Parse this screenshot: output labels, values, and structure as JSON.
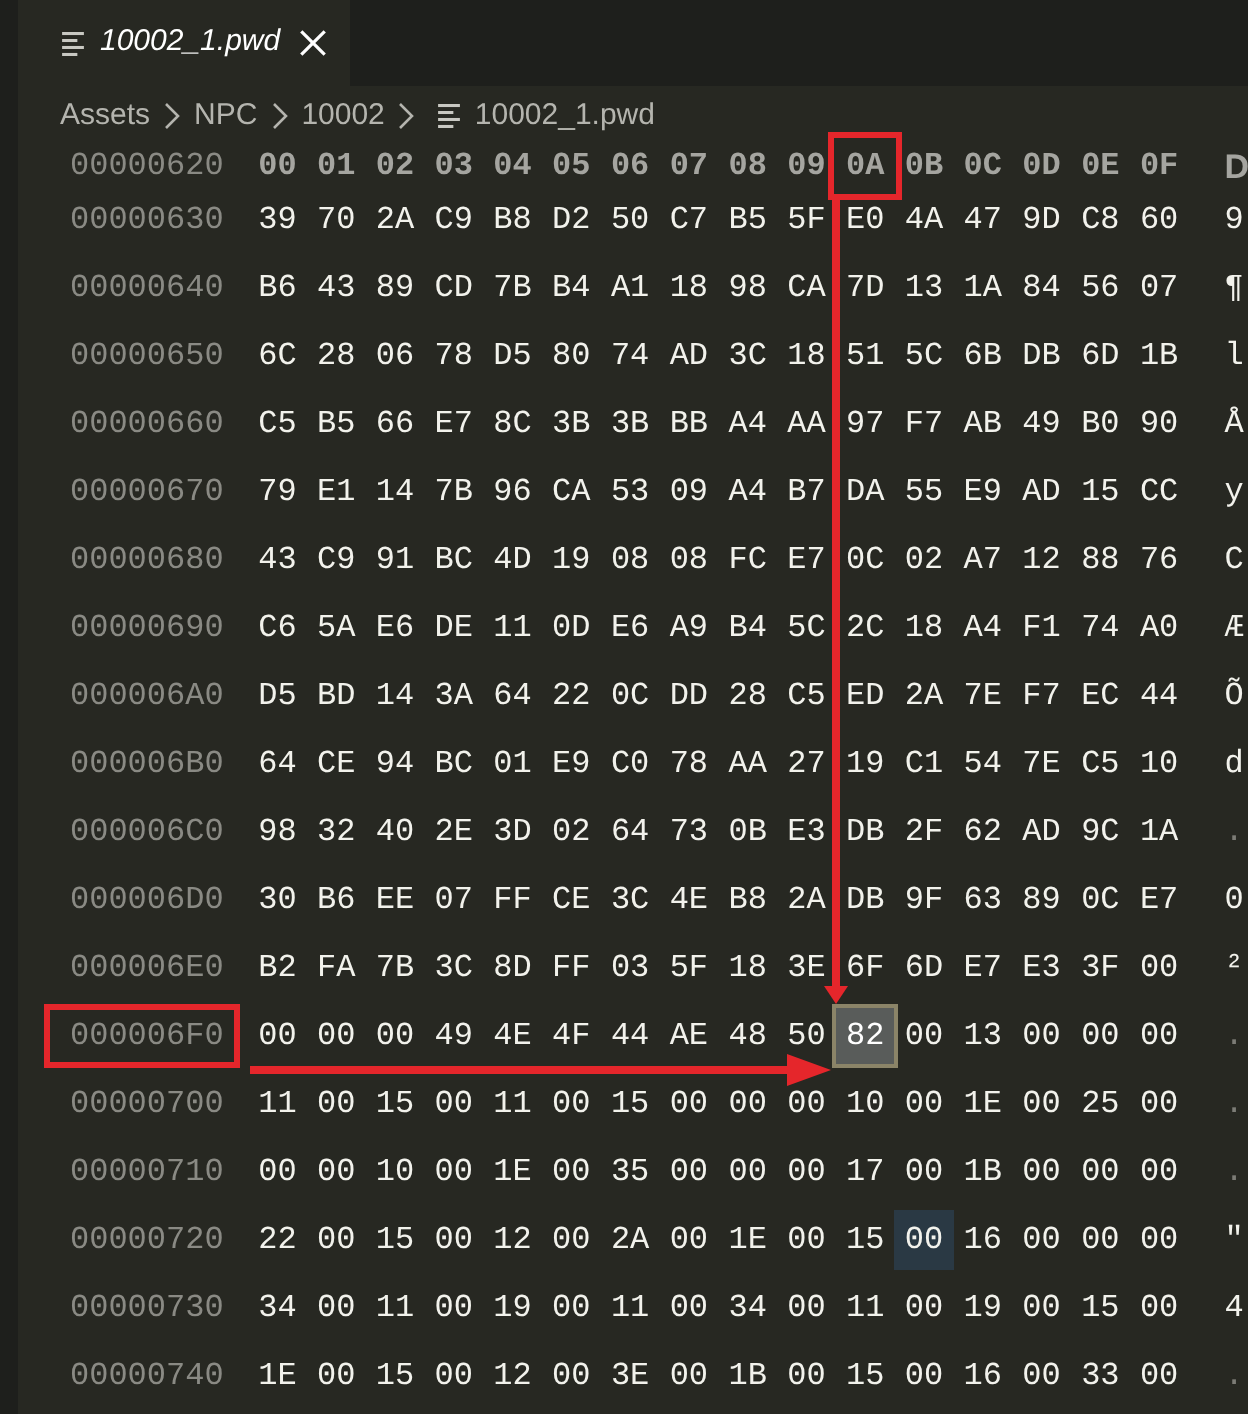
{
  "tabs": [
    {
      "title": "10002_1.pwd",
      "preview": true,
      "selected": true
    }
  ],
  "breadcrumb": [
    {
      "label": "Assets",
      "kind": "folder"
    },
    {
      "label": "NPC",
      "kind": "folder"
    },
    {
      "label": "10002",
      "kind": "folder"
    },
    {
      "label": "10002_1.pwd",
      "kind": "file"
    }
  ],
  "hex_view": {
    "header": {
      "address": "00000620",
      "columns": [
        {
          "label": "00",
          "framed": false
        },
        {
          "label": "01",
          "framed": false
        },
        {
          "label": "02",
          "framed": false
        },
        {
          "label": "03",
          "framed": false
        },
        {
          "label": "04",
          "framed": false
        },
        {
          "label": "05",
          "framed": false
        },
        {
          "label": "06",
          "framed": false
        },
        {
          "label": "07",
          "framed": false
        },
        {
          "label": "08",
          "framed": false
        },
        {
          "label": "09",
          "framed": false
        },
        {
          "label": "0A",
          "framed": true
        },
        {
          "label": "0B",
          "framed": false
        },
        {
          "label": "0C",
          "framed": false
        },
        {
          "label": "0D",
          "framed": false
        },
        {
          "label": "0E",
          "framed": false
        },
        {
          "label": "0F",
          "framed": false
        }
      ],
      "decoded_header": "D"
    },
    "rows": [
      {
        "address": "00000630",
        "framed": false,
        "bytes": [
          {
            "value": "39",
            "selected": false,
            "highlighted": false
          },
          {
            "value": "70",
            "selected": false,
            "highlighted": false
          },
          {
            "value": "2A",
            "selected": false,
            "highlighted": false
          },
          {
            "value": "C9",
            "selected": false,
            "highlighted": false
          },
          {
            "value": "B8",
            "selected": false,
            "highlighted": false
          },
          {
            "value": "D2",
            "selected": false,
            "highlighted": false
          },
          {
            "value": "50",
            "selected": false,
            "highlighted": false
          },
          {
            "value": "C7",
            "selected": false,
            "highlighted": false
          },
          {
            "value": "B5",
            "selected": false,
            "highlighted": false
          },
          {
            "value": "5F",
            "selected": false,
            "highlighted": false
          },
          {
            "value": "E0",
            "selected": false,
            "highlighted": false
          },
          {
            "value": "4A",
            "selected": false,
            "highlighted": false
          },
          {
            "value": "47",
            "selected": false,
            "highlighted": false
          },
          {
            "value": "9D",
            "selected": false,
            "highlighted": false
          },
          {
            "value": "C8",
            "selected": false,
            "highlighted": false
          },
          {
            "value": "60",
            "selected": false,
            "highlighted": false
          }
        ],
        "decoded": "9",
        "decoded_printable": true
      },
      {
        "address": "00000640",
        "framed": false,
        "bytes": [
          {
            "value": "B6",
            "selected": false,
            "highlighted": false
          },
          {
            "value": "43",
            "selected": false,
            "highlighted": false
          },
          {
            "value": "89",
            "selected": false,
            "highlighted": false
          },
          {
            "value": "CD",
            "selected": false,
            "highlighted": false
          },
          {
            "value": "7B",
            "selected": false,
            "highlighted": false
          },
          {
            "value": "B4",
            "selected": false,
            "highlighted": false
          },
          {
            "value": "A1",
            "selected": false,
            "highlighted": false
          },
          {
            "value": "18",
            "selected": false,
            "highlighted": false
          },
          {
            "value": "98",
            "selected": false,
            "highlighted": false
          },
          {
            "value": "CA",
            "selected": false,
            "highlighted": false
          },
          {
            "value": "7D",
            "selected": false,
            "highlighted": false
          },
          {
            "value": "13",
            "selected": false,
            "highlighted": false
          },
          {
            "value": "1A",
            "selected": false,
            "highlighted": false
          },
          {
            "value": "84",
            "selected": false,
            "highlighted": false
          },
          {
            "value": "56",
            "selected": false,
            "highlighted": false
          },
          {
            "value": "07",
            "selected": false,
            "highlighted": false
          }
        ],
        "decoded": "¶",
        "decoded_printable": true
      },
      {
        "address": "00000650",
        "framed": false,
        "bytes": [
          {
            "value": "6C",
            "selected": false,
            "highlighted": false
          },
          {
            "value": "28",
            "selected": false,
            "highlighted": false
          },
          {
            "value": "06",
            "selected": false,
            "highlighted": false
          },
          {
            "value": "78",
            "selected": false,
            "highlighted": false
          },
          {
            "value": "D5",
            "selected": false,
            "highlighted": false
          },
          {
            "value": "80",
            "selected": false,
            "highlighted": false
          },
          {
            "value": "74",
            "selected": false,
            "highlighted": false
          },
          {
            "value": "AD",
            "selected": false,
            "highlighted": false
          },
          {
            "value": "3C",
            "selected": false,
            "highlighted": false
          },
          {
            "value": "18",
            "selected": false,
            "highlighted": false
          },
          {
            "value": "51",
            "selected": false,
            "highlighted": false
          },
          {
            "value": "5C",
            "selected": false,
            "highlighted": false
          },
          {
            "value": "6B",
            "selected": false,
            "highlighted": false
          },
          {
            "value": "DB",
            "selected": false,
            "highlighted": false
          },
          {
            "value": "6D",
            "selected": false,
            "highlighted": false
          },
          {
            "value": "1B",
            "selected": false,
            "highlighted": false
          }
        ],
        "decoded": "l",
        "decoded_printable": true
      },
      {
        "address": "00000660",
        "framed": false,
        "bytes": [
          {
            "value": "C5",
            "selected": false,
            "highlighted": false
          },
          {
            "value": "B5",
            "selected": false,
            "highlighted": false
          },
          {
            "value": "66",
            "selected": false,
            "highlighted": false
          },
          {
            "value": "E7",
            "selected": false,
            "highlighted": false
          },
          {
            "value": "8C",
            "selected": false,
            "highlighted": false
          },
          {
            "value": "3B",
            "selected": false,
            "highlighted": false
          },
          {
            "value": "3B",
            "selected": false,
            "highlighted": false
          },
          {
            "value": "BB",
            "selected": false,
            "highlighted": false
          },
          {
            "value": "A4",
            "selected": false,
            "highlighted": false
          },
          {
            "value": "AA",
            "selected": false,
            "highlighted": false
          },
          {
            "value": "97",
            "selected": false,
            "highlighted": false
          },
          {
            "value": "F7",
            "selected": false,
            "highlighted": false
          },
          {
            "value": "AB",
            "selected": false,
            "highlighted": false
          },
          {
            "value": "49",
            "selected": false,
            "highlighted": false
          },
          {
            "value": "B0",
            "selected": false,
            "highlighted": false
          },
          {
            "value": "90",
            "selected": false,
            "highlighted": false
          }
        ],
        "decoded": "Å",
        "decoded_printable": true
      },
      {
        "address": "00000670",
        "framed": false,
        "bytes": [
          {
            "value": "79",
            "selected": false,
            "highlighted": false
          },
          {
            "value": "E1",
            "selected": false,
            "highlighted": false
          },
          {
            "value": "14",
            "selected": false,
            "highlighted": false
          },
          {
            "value": "7B",
            "selected": false,
            "highlighted": false
          },
          {
            "value": "96",
            "selected": false,
            "highlighted": false
          },
          {
            "value": "CA",
            "selected": false,
            "highlighted": false
          },
          {
            "value": "53",
            "selected": false,
            "highlighted": false
          },
          {
            "value": "09",
            "selected": false,
            "highlighted": false
          },
          {
            "value": "A4",
            "selected": false,
            "highlighted": false
          },
          {
            "value": "B7",
            "selected": false,
            "highlighted": false
          },
          {
            "value": "DA",
            "selected": false,
            "highlighted": false
          },
          {
            "value": "55",
            "selected": false,
            "highlighted": false
          },
          {
            "value": "E9",
            "selected": false,
            "highlighted": false
          },
          {
            "value": "AD",
            "selected": false,
            "highlighted": false
          },
          {
            "value": "15",
            "selected": false,
            "highlighted": false
          },
          {
            "value": "CC",
            "selected": false,
            "highlighted": false
          }
        ],
        "decoded": "y",
        "decoded_printable": true
      },
      {
        "address": "00000680",
        "framed": false,
        "bytes": [
          {
            "value": "43",
            "selected": false,
            "highlighted": false
          },
          {
            "value": "C9",
            "selected": false,
            "highlighted": false
          },
          {
            "value": "91",
            "selected": false,
            "highlighted": false
          },
          {
            "value": "BC",
            "selected": false,
            "highlighted": false
          },
          {
            "value": "4D",
            "selected": false,
            "highlighted": false
          },
          {
            "value": "19",
            "selected": false,
            "highlighted": false
          },
          {
            "value": "08",
            "selected": false,
            "highlighted": false
          },
          {
            "value": "08",
            "selected": false,
            "highlighted": false
          },
          {
            "value": "FC",
            "selected": false,
            "highlighted": false
          },
          {
            "value": "E7",
            "selected": false,
            "highlighted": false
          },
          {
            "value": "0C",
            "selected": false,
            "highlighted": false
          },
          {
            "value": "02",
            "selected": false,
            "highlighted": false
          },
          {
            "value": "A7",
            "selected": false,
            "highlighted": false
          },
          {
            "value": "12",
            "selected": false,
            "highlighted": false
          },
          {
            "value": "88",
            "selected": false,
            "highlighted": false
          },
          {
            "value": "76",
            "selected": false,
            "highlighted": false
          }
        ],
        "decoded": "C",
        "decoded_printable": true
      },
      {
        "address": "00000690",
        "framed": false,
        "bytes": [
          {
            "value": "C6",
            "selected": false,
            "highlighted": false
          },
          {
            "value": "5A",
            "selected": false,
            "highlighted": false
          },
          {
            "value": "E6",
            "selected": false,
            "highlighted": false
          },
          {
            "value": "DE",
            "selected": false,
            "highlighted": false
          },
          {
            "value": "11",
            "selected": false,
            "highlighted": false
          },
          {
            "value": "0D",
            "selected": false,
            "highlighted": false
          },
          {
            "value": "E6",
            "selected": false,
            "highlighted": false
          },
          {
            "value": "A9",
            "selected": false,
            "highlighted": false
          },
          {
            "value": "B4",
            "selected": false,
            "highlighted": false
          },
          {
            "value": "5C",
            "selected": false,
            "highlighted": false
          },
          {
            "value": "2C",
            "selected": false,
            "highlighted": false
          },
          {
            "value": "18",
            "selected": false,
            "highlighted": false
          },
          {
            "value": "A4",
            "selected": false,
            "highlighted": false
          },
          {
            "value": "F1",
            "selected": false,
            "highlighted": false
          },
          {
            "value": "74",
            "selected": false,
            "highlighted": false
          },
          {
            "value": "A0",
            "selected": false,
            "highlighted": false
          }
        ],
        "decoded": "Æ",
        "decoded_printable": true
      },
      {
        "address": "000006A0",
        "framed": false,
        "bytes": [
          {
            "value": "D5",
            "selected": false,
            "highlighted": false
          },
          {
            "value": "BD",
            "selected": false,
            "highlighted": false
          },
          {
            "value": "14",
            "selected": false,
            "highlighted": false
          },
          {
            "value": "3A",
            "selected": false,
            "highlighted": false
          },
          {
            "value": "64",
            "selected": false,
            "highlighted": false
          },
          {
            "value": "22",
            "selected": false,
            "highlighted": false
          },
          {
            "value": "0C",
            "selected": false,
            "highlighted": false
          },
          {
            "value": "DD",
            "selected": false,
            "highlighted": false
          },
          {
            "value": "28",
            "selected": false,
            "highlighted": false
          },
          {
            "value": "C5",
            "selected": false,
            "highlighted": false
          },
          {
            "value": "ED",
            "selected": false,
            "highlighted": false
          },
          {
            "value": "2A",
            "selected": false,
            "highlighted": false
          },
          {
            "value": "7E",
            "selected": false,
            "highlighted": false
          },
          {
            "value": "F7",
            "selected": false,
            "highlighted": false
          },
          {
            "value": "EC",
            "selected": false,
            "highlighted": false
          },
          {
            "value": "44",
            "selected": false,
            "highlighted": false
          }
        ],
        "decoded": "Õ",
        "decoded_printable": true
      },
      {
        "address": "000006B0",
        "framed": false,
        "bytes": [
          {
            "value": "64",
            "selected": false,
            "highlighted": false
          },
          {
            "value": "CE",
            "selected": false,
            "highlighted": false
          },
          {
            "value": "94",
            "selected": false,
            "highlighted": false
          },
          {
            "value": "BC",
            "selected": false,
            "highlighted": false
          },
          {
            "value": "01",
            "selected": false,
            "highlighted": false
          },
          {
            "value": "E9",
            "selected": false,
            "highlighted": false
          },
          {
            "value": "C0",
            "selected": false,
            "highlighted": false
          },
          {
            "value": "78",
            "selected": false,
            "highlighted": false
          },
          {
            "value": "AA",
            "selected": false,
            "highlighted": false
          },
          {
            "value": "27",
            "selected": false,
            "highlighted": false
          },
          {
            "value": "19",
            "selected": false,
            "highlighted": false
          },
          {
            "value": "C1",
            "selected": false,
            "highlighted": false
          },
          {
            "value": "54",
            "selected": false,
            "highlighted": false
          },
          {
            "value": "7E",
            "selected": false,
            "highlighted": false
          },
          {
            "value": "C5",
            "selected": false,
            "highlighted": false
          },
          {
            "value": "10",
            "selected": false,
            "highlighted": false
          }
        ],
        "decoded": "d",
        "decoded_printable": true
      },
      {
        "address": "000006C0",
        "framed": false,
        "bytes": [
          {
            "value": "98",
            "selected": false,
            "highlighted": false
          },
          {
            "value": "32",
            "selected": false,
            "highlighted": false
          },
          {
            "value": "40",
            "selected": false,
            "highlighted": false
          },
          {
            "value": "2E",
            "selected": false,
            "highlighted": false
          },
          {
            "value": "3D",
            "selected": false,
            "highlighted": false
          },
          {
            "value": "02",
            "selected": false,
            "highlighted": false
          },
          {
            "value": "64",
            "selected": false,
            "highlighted": false
          },
          {
            "value": "73",
            "selected": false,
            "highlighted": false
          },
          {
            "value": "0B",
            "selected": false,
            "highlighted": false
          },
          {
            "value": "E3",
            "selected": false,
            "highlighted": false
          },
          {
            "value": "DB",
            "selected": false,
            "highlighted": false
          },
          {
            "value": "2F",
            "selected": false,
            "highlighted": false
          },
          {
            "value": "62",
            "selected": false,
            "highlighted": false
          },
          {
            "value": "AD",
            "selected": false,
            "highlighted": false
          },
          {
            "value": "9C",
            "selected": false,
            "highlighted": false
          },
          {
            "value": "1A",
            "selected": false,
            "highlighted": false
          }
        ],
        "decoded": ".",
        "decoded_printable": false
      },
      {
        "address": "000006D0",
        "framed": false,
        "bytes": [
          {
            "value": "30",
            "selected": false,
            "highlighted": false
          },
          {
            "value": "B6",
            "selected": false,
            "highlighted": false
          },
          {
            "value": "EE",
            "selected": false,
            "highlighted": false
          },
          {
            "value": "07",
            "selected": false,
            "highlighted": false
          },
          {
            "value": "FF",
            "selected": false,
            "highlighted": false
          },
          {
            "value": "CE",
            "selected": false,
            "highlighted": false
          },
          {
            "value": "3C",
            "selected": false,
            "highlighted": false
          },
          {
            "value": "4E",
            "selected": false,
            "highlighted": false
          },
          {
            "value": "B8",
            "selected": false,
            "highlighted": false
          },
          {
            "value": "2A",
            "selected": false,
            "highlighted": false
          },
          {
            "value": "DB",
            "selected": false,
            "highlighted": false
          },
          {
            "value": "9F",
            "selected": false,
            "highlighted": false
          },
          {
            "value": "63",
            "selected": false,
            "highlighted": false
          },
          {
            "value": "89",
            "selected": false,
            "highlighted": false
          },
          {
            "value": "0C",
            "selected": false,
            "highlighted": false
          },
          {
            "value": "E7",
            "selected": false,
            "highlighted": false
          }
        ],
        "decoded": "0",
        "decoded_printable": true
      },
      {
        "address": "000006E0",
        "framed": false,
        "bytes": [
          {
            "value": "B2",
            "selected": false,
            "highlighted": false
          },
          {
            "value": "FA",
            "selected": false,
            "highlighted": false
          },
          {
            "value": "7B",
            "selected": false,
            "highlighted": false
          },
          {
            "value": "3C",
            "selected": false,
            "highlighted": false
          },
          {
            "value": "8D",
            "selected": false,
            "highlighted": false
          },
          {
            "value": "FF",
            "selected": false,
            "highlighted": false
          },
          {
            "value": "03",
            "selected": false,
            "highlighted": false
          },
          {
            "value": "5F",
            "selected": false,
            "highlighted": false
          },
          {
            "value": "18",
            "selected": false,
            "highlighted": false
          },
          {
            "value": "3E",
            "selected": false,
            "highlighted": false
          },
          {
            "value": "6F",
            "selected": false,
            "highlighted": false
          },
          {
            "value": "6D",
            "selected": false,
            "highlighted": false
          },
          {
            "value": "E7",
            "selected": false,
            "highlighted": false
          },
          {
            "value": "E3",
            "selected": false,
            "highlighted": false
          },
          {
            "value": "3F",
            "selected": false,
            "highlighted": false
          },
          {
            "value": "00",
            "selected": false,
            "highlighted": false
          }
        ],
        "decoded": "²",
        "decoded_printable": true
      },
      {
        "address": "000006F0",
        "framed": true,
        "bytes": [
          {
            "value": "00",
            "selected": false,
            "highlighted": false
          },
          {
            "value": "00",
            "selected": false,
            "highlighted": false
          },
          {
            "value": "00",
            "selected": false,
            "highlighted": false
          },
          {
            "value": "49",
            "selected": false,
            "highlighted": false
          },
          {
            "value": "4E",
            "selected": false,
            "highlighted": false
          },
          {
            "value": "4F",
            "selected": false,
            "highlighted": false
          },
          {
            "value": "44",
            "selected": false,
            "highlighted": false
          },
          {
            "value": "AE",
            "selected": false,
            "highlighted": false
          },
          {
            "value": "48",
            "selected": false,
            "highlighted": false
          },
          {
            "value": "50",
            "selected": false,
            "highlighted": false
          },
          {
            "value": "82",
            "selected": true,
            "highlighted": false
          },
          {
            "value": "00",
            "selected": false,
            "highlighted": false
          },
          {
            "value": "13",
            "selected": false,
            "highlighted": false
          },
          {
            "value": "00",
            "selected": false,
            "highlighted": false
          },
          {
            "value": "00",
            "selected": false,
            "highlighted": false
          },
          {
            "value": "00",
            "selected": false,
            "highlighted": false
          }
        ],
        "decoded": ".",
        "decoded_printable": false
      },
      {
        "address": "00000700",
        "framed": false,
        "bytes": [
          {
            "value": "11",
            "selected": false,
            "highlighted": false
          },
          {
            "value": "00",
            "selected": false,
            "highlighted": false
          },
          {
            "value": "15",
            "selected": false,
            "highlighted": false
          },
          {
            "value": "00",
            "selected": false,
            "highlighted": false
          },
          {
            "value": "11",
            "selected": false,
            "highlighted": false
          },
          {
            "value": "00",
            "selected": false,
            "highlighted": false
          },
          {
            "value": "15",
            "selected": false,
            "highlighted": false
          },
          {
            "value": "00",
            "selected": false,
            "highlighted": false
          },
          {
            "value": "00",
            "selected": false,
            "highlighted": false
          },
          {
            "value": "00",
            "selected": false,
            "highlighted": false
          },
          {
            "value": "10",
            "selected": false,
            "highlighted": false
          },
          {
            "value": "00",
            "selected": false,
            "highlighted": false
          },
          {
            "value": "1E",
            "selected": false,
            "highlighted": false
          },
          {
            "value": "00",
            "selected": false,
            "highlighted": false
          },
          {
            "value": "25",
            "selected": false,
            "highlighted": false
          },
          {
            "value": "00",
            "selected": false,
            "highlighted": false
          }
        ],
        "decoded": ".",
        "decoded_printable": false
      },
      {
        "address": "00000710",
        "framed": false,
        "bytes": [
          {
            "value": "00",
            "selected": false,
            "highlighted": false
          },
          {
            "value": "00",
            "selected": false,
            "highlighted": false
          },
          {
            "value": "10",
            "selected": false,
            "highlighted": false
          },
          {
            "value": "00",
            "selected": false,
            "highlighted": false
          },
          {
            "value": "1E",
            "selected": false,
            "highlighted": false
          },
          {
            "value": "00",
            "selected": false,
            "highlighted": false
          },
          {
            "value": "35",
            "selected": false,
            "highlighted": false
          },
          {
            "value": "00",
            "selected": false,
            "highlighted": false
          },
          {
            "value": "00",
            "selected": false,
            "highlighted": false
          },
          {
            "value": "00",
            "selected": false,
            "highlighted": false
          },
          {
            "value": "17",
            "selected": false,
            "highlighted": false
          },
          {
            "value": "00",
            "selected": false,
            "highlighted": false
          },
          {
            "value": "1B",
            "selected": false,
            "highlighted": false
          },
          {
            "value": "00",
            "selected": false,
            "highlighted": false
          },
          {
            "value": "00",
            "selected": false,
            "highlighted": false
          },
          {
            "value": "00",
            "selected": false,
            "highlighted": false
          }
        ],
        "decoded": ".",
        "decoded_printable": false
      },
      {
        "address": "00000720",
        "framed": false,
        "bytes": [
          {
            "value": "22",
            "selected": false,
            "highlighted": false
          },
          {
            "value": "00",
            "selected": false,
            "highlighted": false
          },
          {
            "value": "15",
            "selected": false,
            "highlighted": false
          },
          {
            "value": "00",
            "selected": false,
            "highlighted": false
          },
          {
            "value": "12",
            "selected": false,
            "highlighted": false
          },
          {
            "value": "00",
            "selected": false,
            "highlighted": false
          },
          {
            "value": "2A",
            "selected": false,
            "highlighted": false
          },
          {
            "value": "00",
            "selected": false,
            "highlighted": false
          },
          {
            "value": "1E",
            "selected": false,
            "highlighted": false
          },
          {
            "value": "00",
            "selected": false,
            "highlighted": false
          },
          {
            "value": "15",
            "selected": false,
            "highlighted": false
          },
          {
            "value": "00",
            "selected": false,
            "highlighted": true
          },
          {
            "value": "16",
            "selected": false,
            "highlighted": false
          },
          {
            "value": "00",
            "selected": false,
            "highlighted": false
          },
          {
            "value": "00",
            "selected": false,
            "highlighted": false
          },
          {
            "value": "00",
            "selected": false,
            "highlighted": false
          }
        ],
        "decoded": "\"",
        "decoded_printable": true
      },
      {
        "address": "00000730",
        "framed": false,
        "bytes": [
          {
            "value": "34",
            "selected": false,
            "highlighted": false
          },
          {
            "value": "00",
            "selected": false,
            "highlighted": false
          },
          {
            "value": "11",
            "selected": false,
            "highlighted": false
          },
          {
            "value": "00",
            "selected": false,
            "highlighted": false
          },
          {
            "value": "19",
            "selected": false,
            "highlighted": false
          },
          {
            "value": "00",
            "selected": false,
            "highlighted": false
          },
          {
            "value": "11",
            "selected": false,
            "highlighted": false
          },
          {
            "value": "00",
            "selected": false,
            "highlighted": false
          },
          {
            "value": "34",
            "selected": false,
            "highlighted": false
          },
          {
            "value": "00",
            "selected": false,
            "highlighted": false
          },
          {
            "value": "11",
            "selected": false,
            "highlighted": false
          },
          {
            "value": "00",
            "selected": false,
            "highlighted": false
          },
          {
            "value": "19",
            "selected": false,
            "highlighted": false
          },
          {
            "value": "00",
            "selected": false,
            "highlighted": false
          },
          {
            "value": "15",
            "selected": false,
            "highlighted": false
          },
          {
            "value": "00",
            "selected": false,
            "highlighted": false
          }
        ],
        "decoded": "4",
        "decoded_printable": true
      },
      {
        "address": "00000740",
        "framed": false,
        "bytes": [
          {
            "value": "1E",
            "selected": false,
            "highlighted": false
          },
          {
            "value": "00",
            "selected": false,
            "highlighted": false
          },
          {
            "value": "15",
            "selected": false,
            "highlighted": false
          },
          {
            "value": "00",
            "selected": false,
            "highlighted": false
          },
          {
            "value": "12",
            "selected": false,
            "highlighted": false
          },
          {
            "value": "00",
            "selected": false,
            "highlighted": false
          },
          {
            "value": "3E",
            "selected": false,
            "highlighted": false
          },
          {
            "value": "00",
            "selected": false,
            "highlighted": false
          },
          {
            "value": "1B",
            "selected": false,
            "highlighted": false
          },
          {
            "value": "00",
            "selected": false,
            "highlighted": false
          },
          {
            "value": "15",
            "selected": false,
            "highlighted": false
          },
          {
            "value": "00",
            "selected": false,
            "highlighted": false
          },
          {
            "value": "16",
            "selected": false,
            "highlighted": false
          },
          {
            "value": "00",
            "selected": false,
            "highlighted": false
          },
          {
            "value": "33",
            "selected": false,
            "highlighted": false
          },
          {
            "value": "00",
            "selected": false,
            "highlighted": false
          }
        ],
        "decoded": ".",
        "decoded_printable": false
      }
    ]
  }
}
